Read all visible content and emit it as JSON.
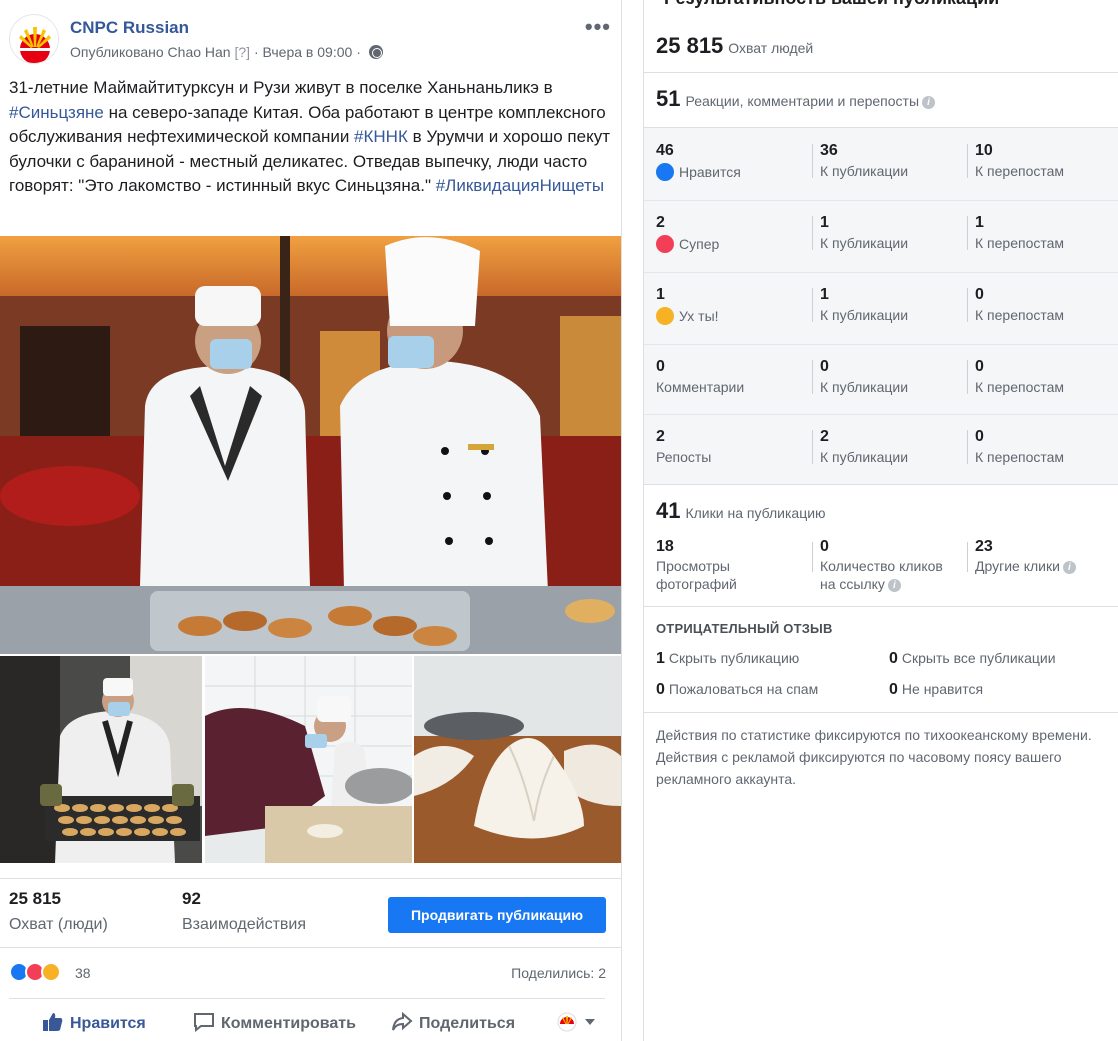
{
  "post": {
    "page_name": "CNPC Russian",
    "published_by": "Опубликовано Chao Han",
    "help_mark": "[?]",
    "time": "Вчера в 09:00",
    "separator": "·",
    "more": "•••",
    "text_parts": [
      {
        "t": "31-летние Маймайтитурксун и Рузи живут в поселке Ханьнаньликэ в ",
        "tag": false
      },
      {
        "t": "#Синьцзяне",
        "tag": true
      },
      {
        "t": " на северо-западе Китая. Оба работают в центре комплексного обслуживания нефтехимической компании ",
        "tag": false
      },
      {
        "t": "#КННК",
        "tag": true
      },
      {
        "t": " в Урумчи и хорошо пекут булочки с бараниной - местный деликатес. Отведав выпечку, люди часто говорят: \"Это лакомство - истинный вкус Синьцзяна.\" ",
        "tag": false
      },
      {
        "t": "#ЛиквидацияНищеты",
        "tag": true
      }
    ],
    "stats": {
      "reach_value": "25 815",
      "reach_label": "Охват (люди)",
      "engagement_value": "92",
      "engagement_label": "Взаимодействия"
    },
    "promote_label": "Продвигать публикацию",
    "reactions_count": "38",
    "shares_label": "Поделились: 2",
    "actions": {
      "like": "Нравится",
      "comment": "Комментировать",
      "share": "Поделиться"
    }
  },
  "panel": {
    "title": "Результативность вашей публикации",
    "reach_value": "25 815",
    "reach_label": "Охват людей",
    "engagement_value": "51",
    "engagement_label": "Реакции, комментарии и перепосты",
    "rows": [
      {
        "total": "46",
        "label": "Нравится",
        "icon": "like-icon",
        "on_post": "36",
        "on_post_label": "К публикации",
        "on_shares": "10",
        "on_shares_label": "К перепостам"
      },
      {
        "total": "2",
        "label": "Супер",
        "icon": "love-icon",
        "on_post": "1",
        "on_post_label": "К публикации",
        "on_shares": "1",
        "on_shares_label": "К перепостам"
      },
      {
        "total": "1",
        "label": "Ух ты!",
        "icon": "wow-icon",
        "on_post": "1",
        "on_post_label": "К публикации",
        "on_shares": "0",
        "on_shares_label": "К перепостам"
      },
      {
        "total": "0",
        "label": "Комментарии",
        "icon": "",
        "on_post": "0",
        "on_post_label": "К публикации",
        "on_shares": "0",
        "on_shares_label": "К перепостам"
      },
      {
        "total": "2",
        "label": "Репосты",
        "icon": "",
        "on_post": "2",
        "on_post_label": "К публикации",
        "on_shares": "0",
        "on_shares_label": "К перепостам"
      }
    ],
    "clicks_value": "41",
    "clicks_label": "Клики на публикацию",
    "clicks": [
      {
        "value": "18",
        "label_1": "Просмотры",
        "label_2": "фотографий"
      },
      {
        "value": "0",
        "label_1": "Количество кликов",
        "label_2": "на ссылку"
      },
      {
        "value": "23",
        "label_1": "Другие клики",
        "label_2": ""
      }
    ],
    "negative_title": "ОТРИЦАТЕЛЬНЫЙ ОТЗЫВ",
    "negative": [
      {
        "value": "1",
        "label": "Скрыть публикацию"
      },
      {
        "value": "0",
        "label": "Скрыть все публикации"
      },
      {
        "value": "0",
        "label": "Пожаловаться на спам"
      },
      {
        "value": "0",
        "label": "Не нравится"
      }
    ],
    "footnote": "Действия по статистике фиксируются по тихоокеанскому времени. Действия с рекламой фиксируются по часовому поясу вашего рекламного аккаунта."
  },
  "colors": {
    "accent": "#1877f2",
    "link": "#365899",
    "like": "#1877f2",
    "love": "#f33e58",
    "wow": "#f7b125"
  }
}
